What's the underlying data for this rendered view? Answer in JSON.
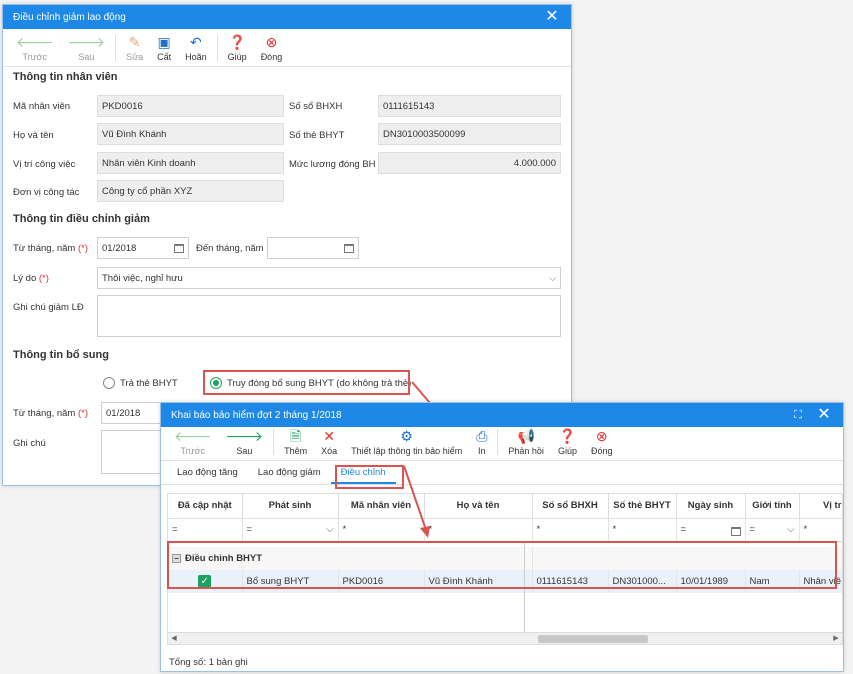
{
  "dialog1": {
    "title": "Điều chỉnh giảm lao động",
    "toolbar": [
      "Trước",
      "Sau",
      "Sửa",
      "Cất",
      "Hoãn",
      "Giúp",
      "Đóng"
    ],
    "sec_employee": "Thông tin nhân viên",
    "lbl_code": "Mã nhân viên",
    "val_code": "PKD0016",
    "lbl_name": "Họ và tên",
    "val_name": "Vũ Đình Khánh",
    "lbl_position": "Vị trí công việc",
    "val_position": "Nhân viên Kinh doanh",
    "lbl_unit": "Đơn vị công tác",
    "val_unit": "Công ty cổ phần XYZ",
    "lbl_bhxh": "Số sổ BHXH",
    "val_bhxh": "0111615143",
    "lbl_bhyt": "Số thẻ BHYT",
    "val_bhyt": "DN3010003500099",
    "lbl_salary": "Mức lương đóng BH",
    "val_salary": "4.000.000",
    "sec_adjust": "Thông tin điều chỉnh giảm",
    "lbl_from": "Từ tháng, năm",
    "val_from": "01/2018",
    "lbl_to": "Đến tháng, năm",
    "lbl_reason": "Lý do",
    "val_reason": "Thôi việc, nghỉ hưu",
    "lbl_note_ld": "Ghi chú giảm LĐ",
    "sec_extra": "Thông tin bổ sung",
    "radio1": "Trả thẻ BHYT",
    "radio2": "Truy đóng bổ sung BHYT (do không trả thẻ)",
    "lbl_from2": "Từ tháng, năm",
    "val_from2": "01/2018",
    "lbl_note": "Ghi chú",
    "req": "(*)"
  },
  "dialog2": {
    "title": "Khai báo bảo hiểm đợt 2 tháng 1/2018",
    "toolbar": [
      "Trước",
      "Sau",
      "Thêm",
      "Xóa",
      "Thiết lập thông tin bảo hiểm",
      "In",
      "Phản hồi",
      "Giúp",
      "Đóng"
    ],
    "tabs": [
      "Lao động tăng",
      "Lao động giảm",
      "Điều chỉnh"
    ],
    "columns": [
      "Đã cập nhật",
      "Phát sinh",
      "Mã nhân viên",
      "Họ và tên",
      "Số sổ BHXH",
      "Số thẻ BHYT",
      "Ngày sinh",
      "Giới tính",
      "Vị trí"
    ],
    "filters": [
      "=",
      "=",
      "*",
      "*",
      "*",
      "*",
      "=",
      "=",
      "*"
    ],
    "group": "Điều chỉnh BHYT",
    "row": [
      "Bổ sung BHYT",
      "PKD0016",
      "Vũ Đình Khánh",
      "0111615143",
      "DN301000...",
      "10/01/1989",
      "Nam",
      "Nhân viê"
    ],
    "footer": "Tổng số: 1 bản ghi"
  },
  "colors": {
    "accent": "#1d88e5",
    "highlight": "#d9534f",
    "check": "#1aa260"
  }
}
